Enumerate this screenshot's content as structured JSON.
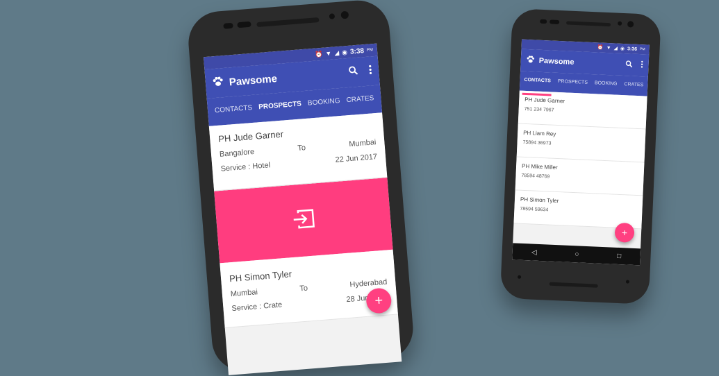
{
  "left_phone": {
    "status_time": "3:38",
    "status_ampm": "PM",
    "app_title": "Pawsome",
    "tabs": [
      "CONTACTS",
      "PROSPECTS",
      "BOOKING",
      "CRATES"
    ],
    "active_tab": "PROSPECTS",
    "cards": [
      {
        "name": "PH Jude Garner",
        "from": "Bangalore",
        "to_label": "To",
        "to": "Mumbai",
        "service": "Service : Hotel",
        "date": "22 Jun 2017"
      },
      {
        "name": "PH Simon Tyler",
        "from": "Mumbai",
        "to_label": "To",
        "to": "Hyderabad",
        "service": "Service : Crate",
        "date": "28 Jun 2017"
      }
    ],
    "swipe_action_icon": "login-icon"
  },
  "right_phone": {
    "status_time": "3:36",
    "status_ampm": "PM",
    "app_title": "Pawsome",
    "tabs": [
      "CONTACTS",
      "PROSPECTS",
      "BOOKING",
      "CRATES"
    ],
    "active_tab": "CONTACTS",
    "contacts": [
      {
        "name": "PH Jude Garner",
        "phone": "751 234 7967"
      },
      {
        "name": "PH Liam Rey",
        "phone": "75894 36973"
      },
      {
        "name": "PH Mike Miller",
        "phone": "78594 48769"
      },
      {
        "name": "PH Simon Tyler",
        "phone": "78594 59634"
      }
    ],
    "fab_label": "+",
    "nav": {
      "back": "◁",
      "home": "○",
      "recents": "□"
    }
  },
  "colors": {
    "primary": "#3f4fb4",
    "accent": "#ff4081",
    "background": "#5f7a88"
  }
}
